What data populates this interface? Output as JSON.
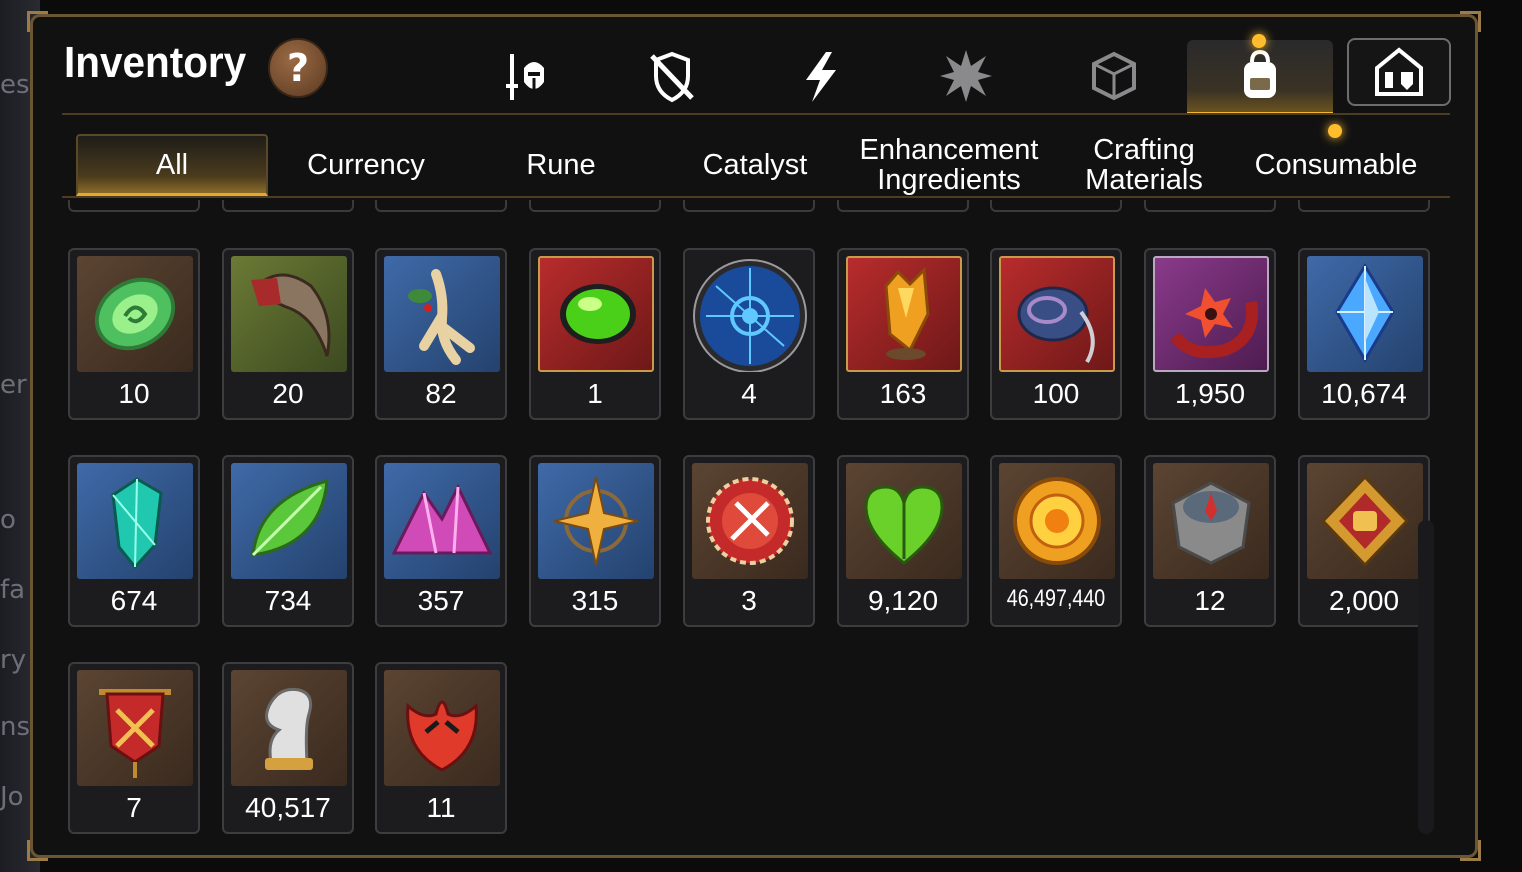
{
  "header": {
    "title": "Inventory",
    "help_label": "?"
  },
  "category_tabs": [
    {
      "name": "gear-tab",
      "icon": "knight-helmet-sword-icon"
    },
    {
      "name": "shield-crossed-tab",
      "icon": "crossed-shield-icon"
    },
    {
      "name": "lightning-tab",
      "icon": "lightning-bolt-icon"
    },
    {
      "name": "burst-tab",
      "icon": "spiky-burst-icon"
    },
    {
      "name": "cube-tab",
      "icon": "cracked-cube-icon"
    },
    {
      "name": "bag-tab",
      "icon": "backpack-icon",
      "active": true
    },
    {
      "name": "guild-tab",
      "icon": "guild-house-icon"
    }
  ],
  "sub_tabs": [
    {
      "label": "All",
      "active": true
    },
    {
      "label": "Currency"
    },
    {
      "label": "Rune"
    },
    {
      "label": "Catalyst"
    },
    {
      "label_line1": "Enhancement",
      "label_line2": "Ingredients"
    },
    {
      "label_line1": "Crafting",
      "label_line2": "Materials"
    },
    {
      "label": "Consumable"
    }
  ],
  "items": [
    {
      "qty": "10",
      "icon": "green-rune-stone-icon"
    },
    {
      "qty": "20",
      "icon": "beast-claw-icon"
    },
    {
      "qty": "82",
      "icon": "ginseng-root-icon"
    },
    {
      "qty": "1",
      "icon": "green-potion-orb-icon"
    },
    {
      "qty": "4",
      "icon": "blue-rune-circle-icon"
    },
    {
      "qty": "163",
      "icon": "amber-crystal-icon"
    },
    {
      "qty": "100",
      "icon": "coiled-horn-icon"
    },
    {
      "qty": "1,950",
      "icon": "red-flower-ring-icon"
    },
    {
      "qty": "10,674",
      "icon": "blue-gem-icon"
    },
    {
      "qty": "674",
      "icon": "teal-crystal-icon"
    },
    {
      "qty": "734",
      "icon": "green-leaf-icon"
    },
    {
      "qty": "357",
      "icon": "pink-crystal-pile-icon"
    },
    {
      "qty": "315",
      "icon": "star-amulet-icon"
    },
    {
      "qty": "3",
      "icon": "red-sword-badge-icon"
    },
    {
      "qty": "9,120",
      "icon": "green-heart-icon"
    },
    {
      "qty": "46,497,440",
      "icon": "gold-sun-coin-icon"
    },
    {
      "qty": "12",
      "icon": "stone-compass-icon"
    },
    {
      "qty": "2,000",
      "icon": "gold-fist-emblem-icon"
    },
    {
      "qty": "7",
      "icon": "red-war-banner-icon"
    },
    {
      "qty": "40,517",
      "icon": "silver-knight-chess-icon"
    },
    {
      "qty": "11",
      "icon": "red-leaf-icon"
    }
  ],
  "colors": {
    "accent": "#f2b632",
    "frame": "#6b5532",
    "slot_bg": "#1c1c1e"
  }
}
